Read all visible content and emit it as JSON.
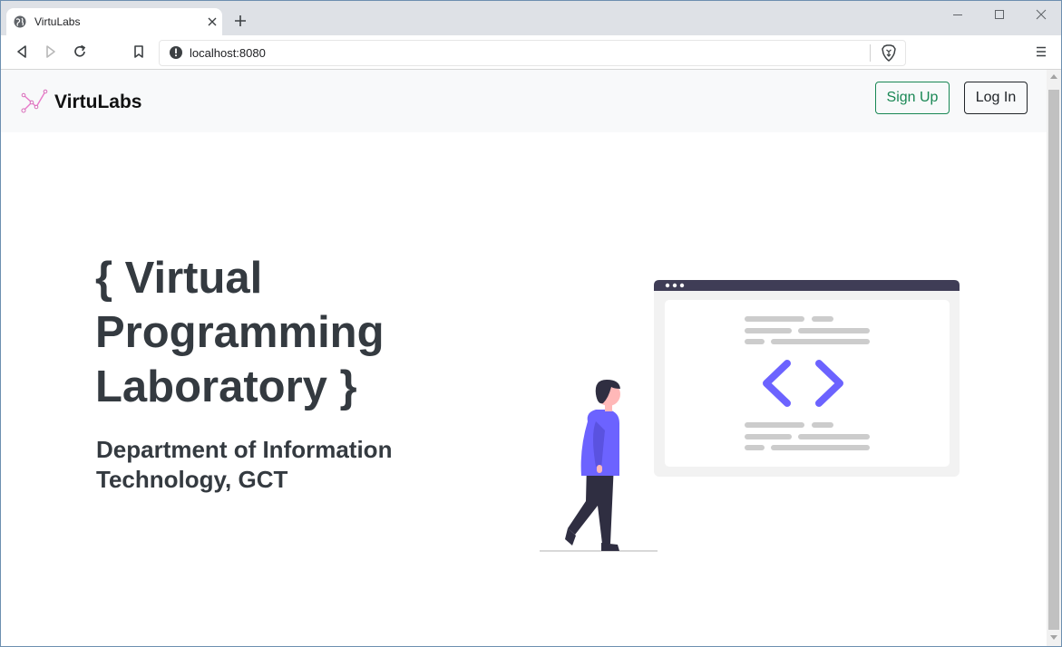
{
  "browser": {
    "tab": {
      "title": "VirtuLabs",
      "favicon": "globe-icon"
    },
    "new_tab_icon": "plus-icon",
    "window_controls": [
      "minimize-icon",
      "maximize-icon",
      "close-icon"
    ],
    "toolbar": {
      "back_icon": "back-arrow-icon",
      "forward_icon": "forward-arrow-icon",
      "reload_icon": "reload-icon",
      "bookmark_icon": "bookmark-icon",
      "menu_icon": "hamburger-menu-icon"
    },
    "address_bar": {
      "url": "localhost:8080",
      "site_info_icon": "info-icon",
      "shield_icon": "brave-shield-icon"
    }
  },
  "navbar": {
    "brand": "VirtuLabs",
    "brand_logo": "virtulabs-logo-icon",
    "signup_label": "Sign Up",
    "login_label": "Log In"
  },
  "hero": {
    "title": "{ Virtual Programming Laboratory }",
    "subtitle": "Department of Information Technology, GCT",
    "illustration": "person-walking-to-code-window-illustration"
  },
  "colors": {
    "accent_purple": "#6c63ff",
    "signup_green": "#198754",
    "heading_dark": "#343a40",
    "navbar_bg": "#f8f9fa",
    "window_header": "#3f3d56"
  }
}
